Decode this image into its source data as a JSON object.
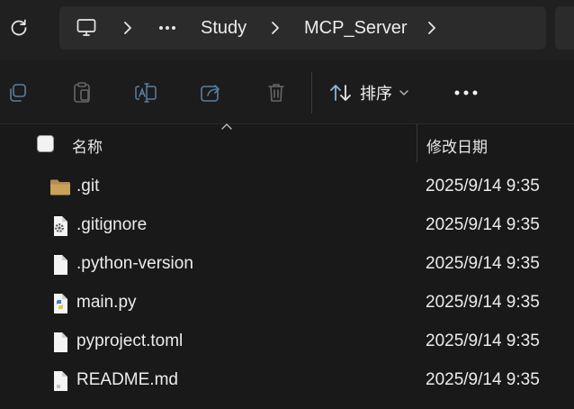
{
  "breadcrumb": {
    "items": [
      "Study",
      "MCP_Server"
    ]
  },
  "toolbar": {
    "sort_label": "排序"
  },
  "columns": {
    "name": "名称",
    "date_modified": "修改日期"
  },
  "files": [
    {
      "name": ".git",
      "date": "2025/9/14 9:35",
      "icon": "folder-icon"
    },
    {
      "name": ".gitignore",
      "date": "2025/9/14 9:35",
      "icon": "settings-file-icon"
    },
    {
      "name": ".python-version",
      "date": "2025/9/14 9:35",
      "icon": "file-icon"
    },
    {
      "name": "main.py",
      "date": "2025/9/14 9:35",
      "icon": "python-file-icon"
    },
    {
      "name": "pyproject.toml",
      "date": "2025/9/14 9:35",
      "icon": "file-icon"
    },
    {
      "name": "README.md",
      "date": "2025/9/14 9:35",
      "icon": "text-file-icon"
    }
  ],
  "colors": {
    "background": "#191919",
    "nav_background": "#202020",
    "address_background": "#2b2b2b",
    "folder": "#c9a15b",
    "python_blue": "#3d7fc4",
    "python_yellow": "#f2c53d"
  }
}
